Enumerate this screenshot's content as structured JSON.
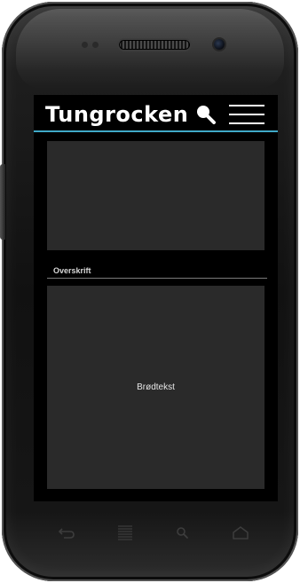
{
  "app": {
    "title": "Tungrocken",
    "accent_color": "#3fa9c8"
  },
  "header": {
    "search_icon": "search-icon",
    "menu_icon": "hamburger-menu-icon"
  },
  "content": {
    "media_placeholder": "",
    "section_heading": "Overskrift",
    "body_text": "Brødtekst"
  },
  "device_nav": {
    "icons": [
      "back-icon",
      "menu-icon",
      "search-icon",
      "home-icon"
    ]
  }
}
